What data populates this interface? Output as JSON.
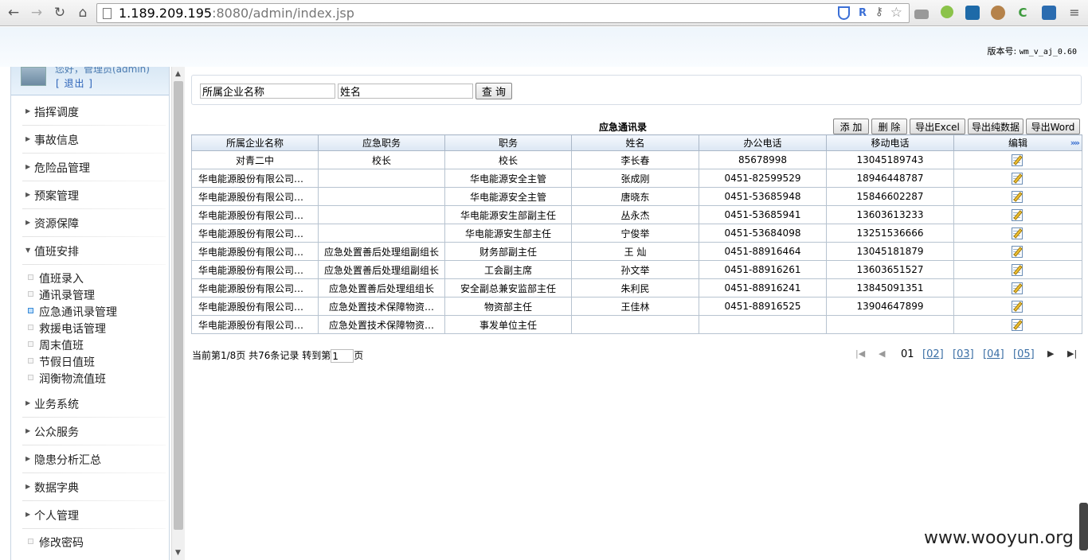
{
  "browser": {
    "url_host": "1.189.209.195",
    "url_rest": ":8080/admin/index.jsp"
  },
  "header": {
    "version_label": "版本号:",
    "version_value": "wm_v_aj_0.60"
  },
  "sidebar": {
    "user_name": "您好，管理员(admin)",
    "logout": "[ 退出 ]",
    "menu_top": [
      {
        "label": "指挥调度"
      },
      {
        "label": "事故信息"
      },
      {
        "label": "危险品管理"
      },
      {
        "label": "预案管理"
      },
      {
        "label": "资源保障"
      },
      {
        "label": "值班安排"
      }
    ],
    "sub_items": [
      {
        "label": "值班录入"
      },
      {
        "label": "通讯录管理"
      },
      {
        "label": "应急通讯录管理"
      },
      {
        "label": "救援电话管理"
      },
      {
        "label": "周末值班"
      },
      {
        "label": "节假日值班"
      },
      {
        "label": "润衡物流值班"
      }
    ],
    "menu_bottom": [
      {
        "label": "业务系统"
      },
      {
        "label": "公众服务"
      },
      {
        "label": "隐患分析汇总"
      },
      {
        "label": "数据字典"
      },
      {
        "label": "个人管理"
      }
    ],
    "last_sub": "修改密码"
  },
  "search": {
    "company_placeholder": "所属企业名称",
    "name_placeholder": "姓名",
    "query_label": "查 询"
  },
  "table": {
    "title": "应急通讯录",
    "buttons": {
      "add": "添 加",
      "delete": "删 除",
      "export_excel": "导出Excel",
      "export_plain": "导出纯数据",
      "export_word": "导出Word"
    },
    "columns": [
      "所属企业名称",
      "应急职务",
      "职务",
      "姓名",
      "办公电话",
      "移动电话",
      "编辑"
    ],
    "rows": [
      [
        "对青二中",
        "校长",
        "校长",
        "李长春",
        "85678998",
        "13045189743"
      ],
      [
        "华电能源股份有限公司…",
        "",
        "华电能源安全主管",
        "张成刚",
        "0451-82599529",
        "18946448787"
      ],
      [
        "华电能源股份有限公司…",
        "",
        "华电能源安全主管",
        "唐晓东",
        "0451-53685948",
        "15846602287"
      ],
      [
        "华电能源股份有限公司…",
        "",
        "华电能源安生部副主任",
        "丛永杰",
        "0451-53685941",
        "13603613233"
      ],
      [
        "华电能源股份有限公司…",
        "",
        "华电能源安生部主任",
        "宁俊举",
        "0451-53684098",
        "13251536666"
      ],
      [
        "华电能源股份有限公司…",
        "应急处置善后处理组副组长",
        "财务部副主任",
        "王 灿",
        "0451-88916464",
        "13045181879"
      ],
      [
        "华电能源股份有限公司…",
        "应急处置善后处理组副组长",
        "工会副主席",
        "孙文举",
        "0451-88916261",
        "13603651527"
      ],
      [
        "华电能源股份有限公司…",
        "应急处置善后处理组组长",
        "安全副总兼安监部主任",
        "朱利民",
        "0451-88916241",
        "13845091351"
      ],
      [
        "华电能源股份有限公司…",
        "应急处置技术保障物资…",
        "物资部主任",
        "王佳林",
        "0451-88916525",
        "13904647899"
      ],
      [
        "华电能源股份有限公司…",
        "应急处置技术保障物资…",
        "事发单位主任",
        "",
        "",
        ""
      ]
    ]
  },
  "pagination": {
    "info_prefix": "当前第1/8页 共76条记录 转到第",
    "goto_value": "1",
    "info_suffix": "页",
    "current": "01",
    "pages": [
      "[02]",
      "[03]",
      "[04]",
      "[05]"
    ]
  },
  "watermark": "www.wooyun.org"
}
